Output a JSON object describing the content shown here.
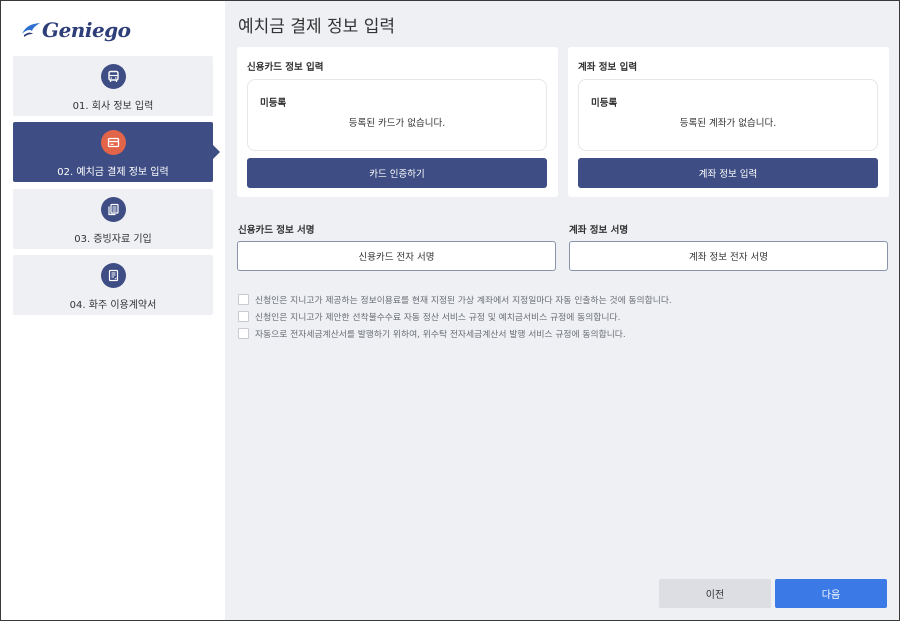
{
  "brand": {
    "logo_text": "Geniego"
  },
  "sidebar": {
    "steps": [
      {
        "label": "01. 회사 정보 입력",
        "icon": "bus-icon"
      },
      {
        "label": "02. 예치금 결제 정보 입력",
        "icon": "card-icon",
        "active": true
      },
      {
        "label": "03. 증빙자료 기입",
        "icon": "documents-icon"
      },
      {
        "label": "04. 화주 이용계약서",
        "icon": "contract-icon"
      }
    ]
  },
  "main": {
    "title": "예치금 결제 정보 입력",
    "card_credit": {
      "title": "신용카드 정보 입력",
      "status": "미등록",
      "message": "등록된 카드가 없습니다.",
      "button": "카드 인증하기"
    },
    "card_account": {
      "title": "계좌 정보 입력",
      "status": "미등록",
      "message": "등록된 계좌가 없습니다.",
      "button": "계좌 정보 입력"
    },
    "sign_credit": {
      "label": "신용카드 정보 서명",
      "button": "신용카드 전자 서명"
    },
    "sign_account": {
      "label": "계좌 정보 서명",
      "button": "계좌 정보 전자 서명"
    },
    "agreements": [
      "신청인은 지니고가 제공하는 정보이용료를 현재 지정된 가상 계좌에서 지정일마다 자동 인출하는 것에 동의합니다.",
      "신청인은 지니고가 제안한 선착불수수료 자동 정산 서비스 규정 및 예치금서비스 규정에 동의합니다.",
      "자동으로 전자세금계산서를 발행하기 위하여, 위수탁 전자세금계산서 발행 서비스 규정에 동의합니다."
    ]
  },
  "footer": {
    "prev": "이전",
    "next": "다음"
  },
  "colors": {
    "primary": "#3e4d84",
    "accent": "#e2654a",
    "next_button": "#3b7ae6",
    "background": "#eef0f4"
  }
}
